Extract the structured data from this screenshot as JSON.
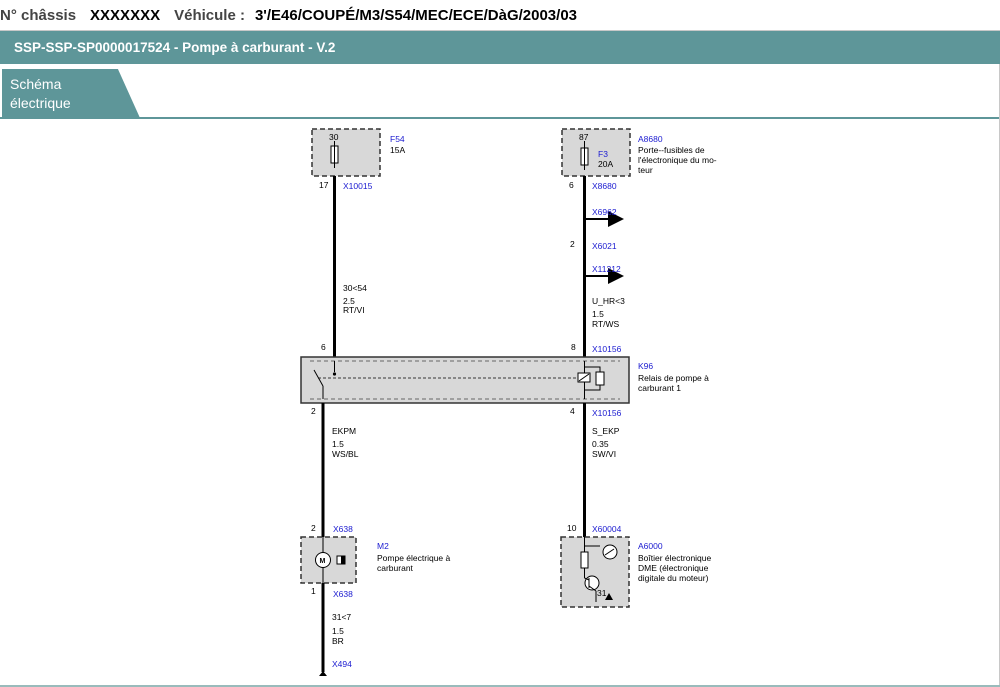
{
  "header": {
    "chassis_label": "N° châssis",
    "chassis_value": "XXXXXXX",
    "vehicle_label": "Véhicule :",
    "vehicle_value": "3'/E46/COUPÉ/M3/S54/MEC/ECE/DàG/2003/03"
  },
  "title": "SSP-SSP-SP0000017524  -  Pompe à carburant  -  V.2",
  "tab": {
    "line1": "Schéma",
    "line2": "électrique"
  },
  "diagram": {
    "f54": {
      "id": "F54",
      "desc": "15A",
      "pin_top": "30",
      "pin_bottom": "17",
      "connector": "X10015"
    },
    "a8680": {
      "id": "A8680",
      "desc1": "Porte--fusibles de",
      "desc2": "l'électronique du mo-",
      "desc3": "teur",
      "pin_top": "87",
      "pin_bottom": "6",
      "connector": "X8680",
      "fuse_id": "F3",
      "fuse_rating": "20A"
    },
    "x6962": "X6962",
    "x6021": {
      "pin": "2",
      "connector": "X6021"
    },
    "x11212": "X11212",
    "wire_left_top": {
      "signal": "30<54",
      "gauge": "2.5",
      "color": "RT/VI"
    },
    "wire_right_top": {
      "signal": "U_HR<3",
      "gauge": "1.5",
      "color": "RT/WS"
    },
    "k96": {
      "id": "K96",
      "desc1": "Relais de pompe à",
      "desc2": "carburant 1",
      "pin_tl": "6",
      "pin_tr": "8",
      "pin_bl": "2",
      "pin_br": "4",
      "conn_top": "X10156",
      "conn_bottom": "X10156"
    },
    "wire_left_mid": {
      "signal": "EKPM",
      "gauge": "1.5",
      "color": "WS/BL"
    },
    "wire_right_mid": {
      "signal": "S_EKP",
      "gauge": "0.35",
      "color": "SW/VI"
    },
    "m2": {
      "id": "M2",
      "desc1": "Pompe électrique à",
      "desc2": "carburant",
      "pin_top": "2",
      "conn_top": "X638",
      "pin_bottom": "1",
      "conn_bottom": "X638",
      "motor_glyph": "M"
    },
    "a6000": {
      "id": "A6000",
      "desc1": "Boîtier électronique",
      "desc2": "DME (électronique",
      "desc3": "digitale du moteur)",
      "pin_top": "10",
      "connector": "X60004",
      "pin_internal": "31"
    },
    "wire_left_bottom": {
      "signal": "31<7",
      "gauge": "1.5",
      "color": "BR"
    },
    "x494": "X494"
  }
}
